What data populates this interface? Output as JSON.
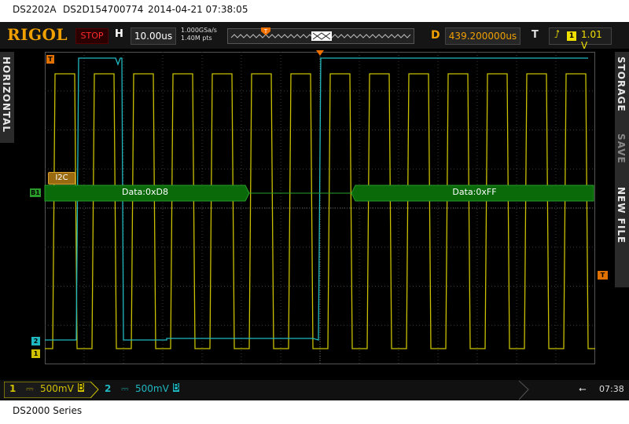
{
  "caption_top": {
    "model": "DS2202A",
    "serial": "DS2D154700774",
    "datetime": "2014-04-21  07:38:05"
  },
  "caption_bottom": {
    "series": "DS2000 Series"
  },
  "status": {
    "brand": "RIGOL",
    "run_state": "STOP",
    "h_label": "H",
    "timebase": "10.00us",
    "sample_rate": "1.000GSa/s",
    "memory_depth": "1.40M pts",
    "delay_label": "D",
    "delay": "439.200000us",
    "trigger_label": "T",
    "trigger_edge": "rising-edge-icon",
    "trigger_channel": "1",
    "trigger_level": "1.01 V"
  },
  "side": {
    "left": "HORIZONTAL",
    "right_storage": "STORAGE",
    "right_save": "SAVE",
    "right_newfile": "NEW FILE"
  },
  "markers": {
    "trigger_pos": "T",
    "bus": "B1",
    "ch2": "2",
    "ch1": "1",
    "trig_level_right": "T"
  },
  "bus": {
    "label": "I2C",
    "frame1": "Data:0xD8",
    "frame2": "Data:0xFF"
  },
  "channels": [
    {
      "num": "1",
      "scale": "500mV",
      "coupling": "DC",
      "color": "#d0c000"
    },
    {
      "num": "2",
      "scale": "500mV",
      "coupling": "DC",
      "color": "#1fb8c0"
    }
  ],
  "time": "07:38",
  "colors": {
    "ch1": "#c8c000",
    "ch2": "#20b8c0",
    "bus": "#0a6a0a",
    "accent": "#f0a000"
  }
}
